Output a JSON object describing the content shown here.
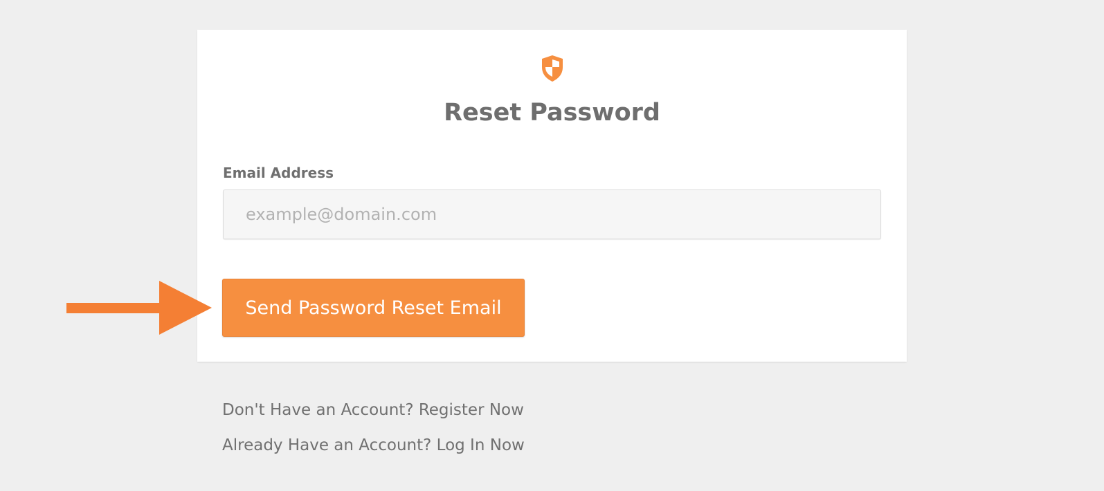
{
  "reset_card": {
    "icon": "shield-icon",
    "title": "Reset Password",
    "email_label": "Email Address",
    "email_value": "",
    "email_placeholder": "example@domain.com",
    "submit_label": "Send Password Reset Email"
  },
  "annotation": {
    "icon": "arrow-right-icon"
  },
  "links": {
    "register": "Don't Have an Account? Register Now",
    "login": "Already Have an Account? Log In Now"
  },
  "colors": {
    "accent": "#f68f40",
    "page_background": "#efefef",
    "card_background": "#ffffff",
    "text": "#6e6e6e"
  }
}
